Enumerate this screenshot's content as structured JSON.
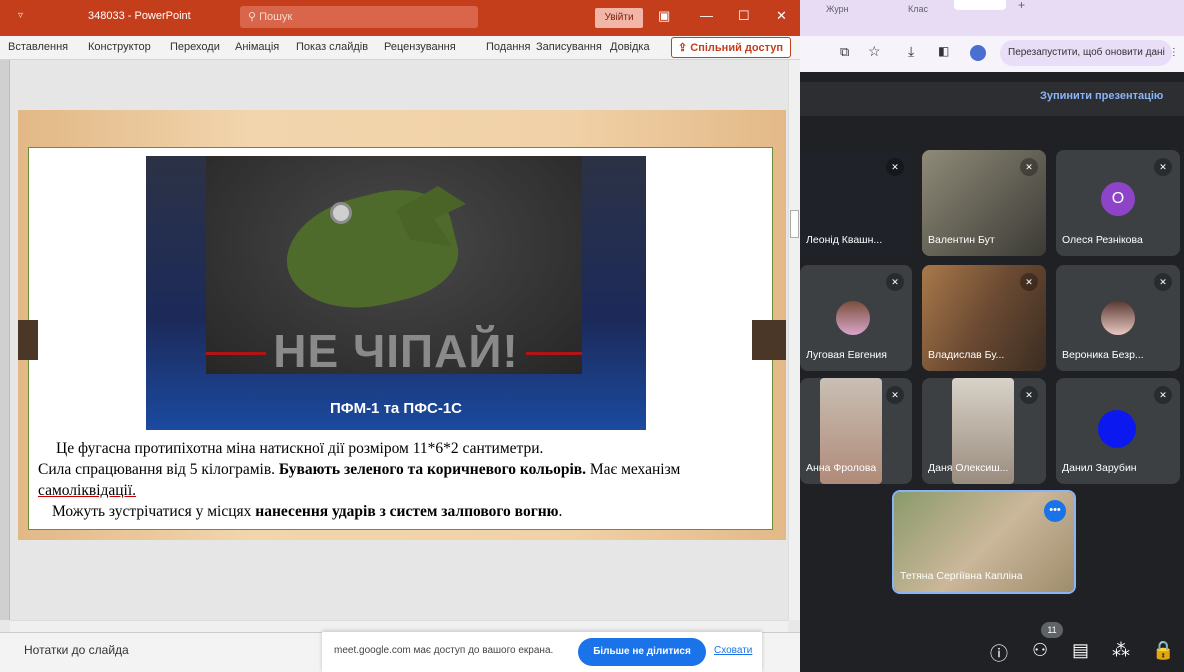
{
  "powerpoint": {
    "quick_access": "▿",
    "title": "348033 - PowerPoint",
    "search_placeholder": "Пошук",
    "sign_in": "Увійти",
    "ribbon_tabs": [
      "Вставлення",
      "Конструктор",
      "Переходи",
      "Анімація",
      "Показ слайдів",
      "Рецензування",
      "Подання",
      "Записування",
      "Довідка"
    ],
    "share_button": "Спільний доступ",
    "notes_label": "Нотатки до слайда"
  },
  "slide": {
    "warning": "НЕ ЧІПАЙ!",
    "image_caption": "ПФМ-1 та ПФС-1С",
    "line1": "Це фугасна протипіхотна міна натискної дії розміром 11*6*2 сантиметри.",
    "line2_a": "Сила спрацювання від 5 кілограмів. ",
    "line2_b": "Бувають зеленого та коричневого кольорів.",
    "line2_c": " Має механізм",
    "line3": "самоліквідації.",
    "line4_a": "Можуть зустрічатися у місцях ",
    "line4_b": "нанесення ударів з систем залпового вогню",
    "line4_c": "."
  },
  "share_bar": {
    "text": "meet.google.com має доступ до вашого екрана.",
    "stop_button": "Більше не ділитися",
    "hide_link": "Сховати"
  },
  "chrome": {
    "tab1": "Журн",
    "tab2": "Клас",
    "relaunch": "Перезапустити, щоб оновити дані"
  },
  "meet": {
    "stop_presenting": "Зупинити презентацію",
    "participants": [
      {
        "name": "Леонід Квашн..."
      },
      {
        "name": "Валентин Бут"
      },
      {
        "name": "Олеся Резнікова",
        "initial": "О"
      },
      {
        "name": "Луговая Евгения"
      },
      {
        "name": "Владислав Бу..."
      },
      {
        "name": "Вероника Безр..."
      },
      {
        "name": "Анна Фролова"
      },
      {
        "name": "Даня Олексиш..."
      },
      {
        "name": "Данил Зарубин"
      },
      {
        "name": "Тетяна Сергіївна Капліна"
      }
    ],
    "participant_count": "11"
  },
  "colors": {
    "ppt_accent": "#c43e1c",
    "meet_bg": "#202124",
    "meet_blue": "#1a73e8",
    "avatar_purple": "#8e44c9",
    "avatar_blue": "#0c18f0"
  }
}
